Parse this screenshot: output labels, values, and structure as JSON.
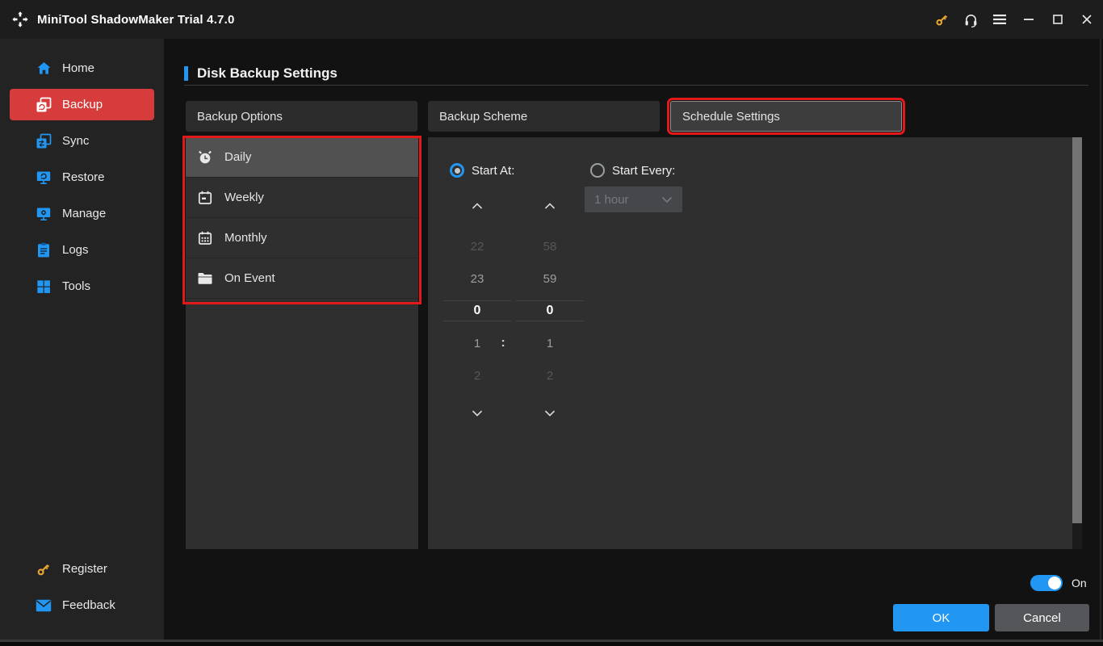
{
  "titlebar": {
    "title": "MiniTool ShadowMaker Trial 4.7.0",
    "icons": [
      "logo-icon",
      "key-icon",
      "headset-icon",
      "menu-icon",
      "minimize-icon",
      "maximize-icon",
      "close-icon"
    ]
  },
  "sidebar": {
    "items": [
      {
        "label": "Home",
        "icon": "home-icon",
        "active": false
      },
      {
        "label": "Backup",
        "icon": "backup-icon",
        "active": true
      },
      {
        "label": "Sync",
        "icon": "sync-icon",
        "active": false
      },
      {
        "label": "Restore",
        "icon": "restore-icon",
        "active": false
      },
      {
        "label": "Manage",
        "icon": "manage-icon",
        "active": false
      },
      {
        "label": "Logs",
        "icon": "logs-icon",
        "active": false
      },
      {
        "label": "Tools",
        "icon": "tools-icon",
        "active": false
      }
    ],
    "footer": [
      {
        "label": "Register",
        "icon": "key-icon"
      },
      {
        "label": "Feedback",
        "icon": "mail-icon"
      }
    ]
  },
  "page": {
    "title": "Disk Backup Settings"
  },
  "tabs": [
    {
      "label": "Backup Options",
      "selected": false,
      "annotated": false
    },
    {
      "label": "Backup Scheme",
      "selected": false,
      "annotated": false
    },
    {
      "label": "Schedule Settings",
      "selected": true,
      "annotated": true
    }
  ],
  "schedule_types": {
    "annotated": true,
    "items": [
      {
        "label": "Daily",
        "icon": "alarm-clock-icon",
        "selected": true
      },
      {
        "label": "Weekly",
        "icon": "calendar-week-icon",
        "selected": false
      },
      {
        "label": "Monthly",
        "icon": "calendar-month-icon",
        "selected": false
      },
      {
        "label": "On Event",
        "icon": "folder-icon",
        "selected": false
      }
    ]
  },
  "schedule_panel": {
    "start_at_label": "Start At:",
    "start_at_selected": true,
    "start_every_label": "Start Every:",
    "start_every_selected": false,
    "interval_dropdown": {
      "value": "1 hour",
      "disabled": true
    },
    "time_picker": {
      "hours": [
        "22",
        "23",
        "0",
        "1",
        "2"
      ],
      "minutes": [
        "58",
        "59",
        "0",
        "1",
        "2"
      ],
      "selected_hour": "0",
      "selected_minute": "0",
      "selected_index": 2,
      "separator": ":"
    }
  },
  "footer": {
    "toggle_state": "On",
    "ok_label": "OK",
    "cancel_label": "Cancel"
  },
  "colors": {
    "accent_blue": "#2196f3",
    "backup_active_red": "#d63c3c",
    "annotation_red": "#e11919",
    "key_gold": "#e8a530",
    "panel_gray": "#2f2f2f"
  }
}
